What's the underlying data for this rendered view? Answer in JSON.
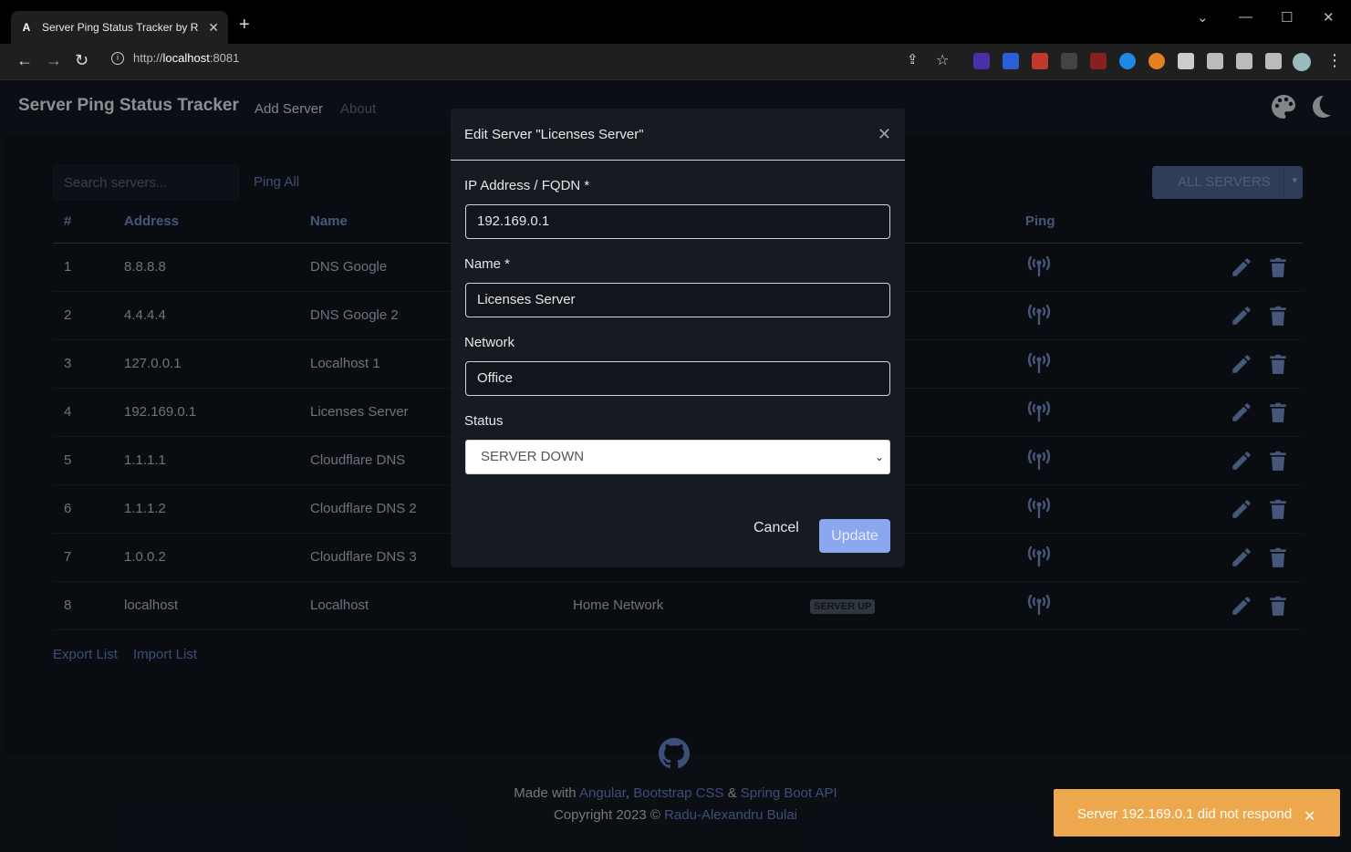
{
  "browser": {
    "tab_title": "Server Ping Status Tracker by Rad",
    "url_scheme": "http://",
    "url_host": "localhost",
    "url_port": ":8081"
  },
  "nav": {
    "brand": "Server Ping Status Tracker",
    "links": [
      "Add Server",
      "About"
    ]
  },
  "toolbar": {
    "search_placeholder": "Search servers...",
    "ping_all": "Ping All",
    "filter": "ALL SERVERS"
  },
  "table": {
    "headers": [
      "#",
      "Address",
      "Name",
      "",
      "",
      "Ping",
      ""
    ],
    "rows": [
      {
        "num": "1",
        "address": "8.8.8.8",
        "name": "DNS Google",
        "network": "",
        "status": ""
      },
      {
        "num": "2",
        "address": "4.4.4.4",
        "name": "DNS Google 2",
        "network": "",
        "status": ""
      },
      {
        "num": "3",
        "address": "127.0.0.1",
        "name": "Localhost 1",
        "network": "",
        "status": ""
      },
      {
        "num": "4",
        "address": "192.169.0.1",
        "name": "Licenses Server",
        "network": "",
        "status": ""
      },
      {
        "num": "5",
        "address": "1.1.1.1",
        "name": "Cloudflare DNS",
        "network": "",
        "status": ""
      },
      {
        "num": "6",
        "address": "1.1.1.2",
        "name": "Cloudflare DNS 2",
        "network": "",
        "status": ""
      },
      {
        "num": "7",
        "address": "1.0.0.2",
        "name": "Cloudflare DNS 3",
        "network": "",
        "status": ""
      },
      {
        "num": "8",
        "address": "localhost",
        "name": "Localhost",
        "network": "Home Network",
        "status": "SERVER UP"
      }
    ]
  },
  "list_actions": {
    "export": "Export List",
    "import": "Import List"
  },
  "footer": {
    "made_with": "Made with",
    "angular": "Angular",
    "comma": ",",
    "bootstrap": "Bootstrap CSS",
    "amp": "&",
    "spring": "Spring Boot API",
    "copyright": "Copyright 2023 ©",
    "author": "Radu-Alexandru Bulai"
  },
  "modal": {
    "title": "Edit Server \"Licenses Server\"",
    "ip_label": "IP Address / FQDN *",
    "ip_value": "192.169.0.1",
    "name_label": "Name *",
    "name_value": "Licenses Server",
    "network_label": "Network",
    "network_value": "Office",
    "status_label": "Status",
    "status_value": "SERVER DOWN",
    "cancel": "Cancel",
    "update": "Update"
  },
  "toast": {
    "message": "Server 192.169.0.1 did not respond"
  },
  "colors": {
    "accent": "#5f79b8",
    "toast": "#eda84d",
    "update_button": "#8aa7f0"
  }
}
